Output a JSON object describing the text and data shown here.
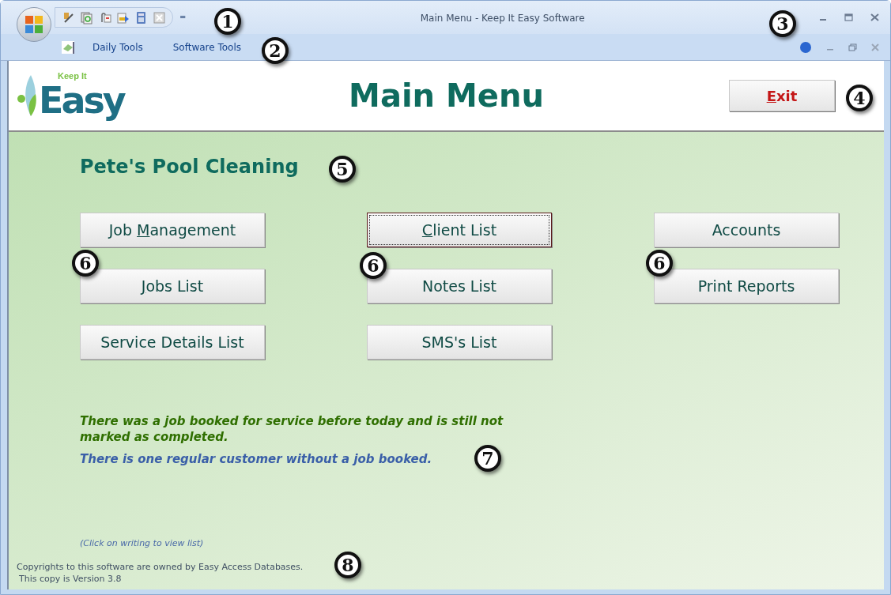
{
  "window": {
    "title": "Main Menu - Keep It Easy Software"
  },
  "quick_access_toolbar": {
    "more": "="
  },
  "menu": {
    "items": [
      "Daily Tools",
      "Software Tools"
    ]
  },
  "header": {
    "logo_small": "Keep It",
    "logo_large": "Easy",
    "title": "Main Menu",
    "exit_button": {
      "key": "E",
      "post": "xit"
    }
  },
  "business_name": "Pete's Pool Cleaning",
  "buttons": [
    {
      "pre": "Job ",
      "key": "M",
      "post": "anagement",
      "focused": false
    },
    {
      "key": "C",
      "post": "lient List",
      "focused": true
    },
    {
      "pre": "Accounts",
      "focused": false
    },
    {
      "key": "J",
      "post": "obs List",
      "focused": false
    },
    {
      "pre": "Notes List",
      "focused": false
    },
    {
      "pre": "Print Reports",
      "focused": false
    },
    {
      "pre": "Service Details List",
      "focused": false
    },
    {
      "pre": "SMS's List",
      "focused": false
    }
  ],
  "messages": [
    {
      "text": "There was a job booked for service before today and is still not marked as completed.",
      "color": "#2f6f00"
    },
    {
      "text": "There is one regular customer without a job booked.",
      "color": "#3a5fa8"
    }
  ],
  "hint": "(Click on writing to view list)",
  "footer": [
    "Copyrights to this software are owned by Easy Access Databases.",
    "This copy is Version 3.8"
  ],
  "callouts": [
    "1",
    "2",
    "3",
    "4",
    "5",
    "6",
    "6",
    "6",
    "7",
    "8"
  ]
}
